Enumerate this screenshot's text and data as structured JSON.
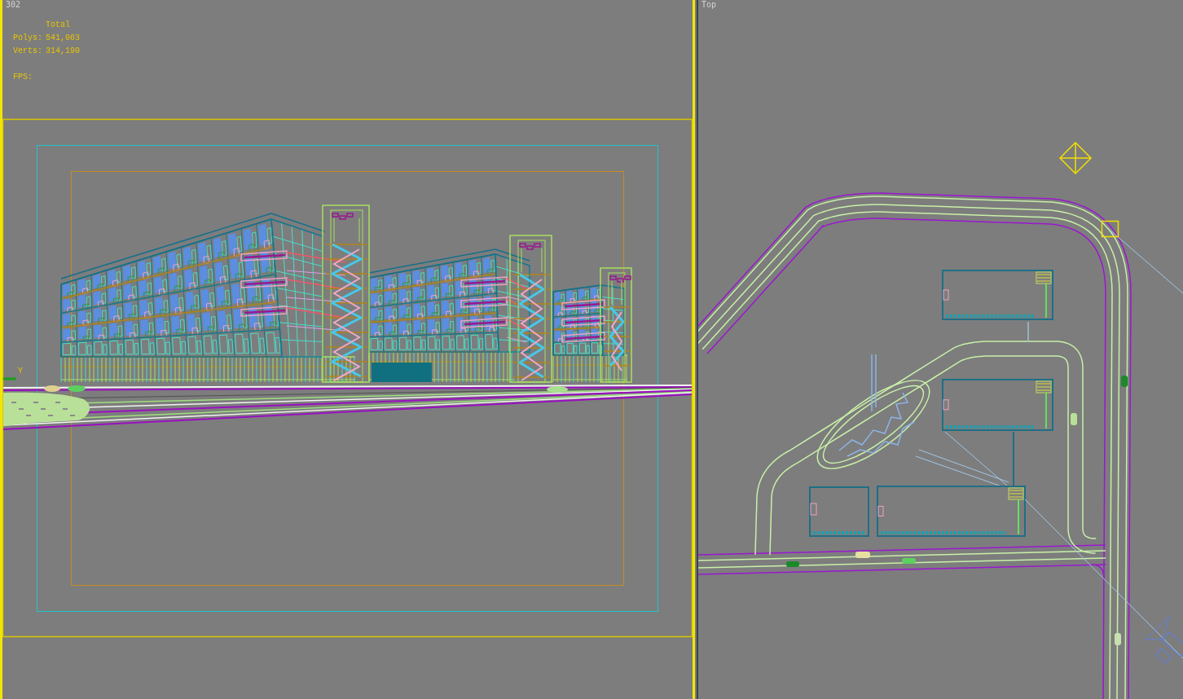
{
  "viewports": [
    {
      "kind": "camera",
      "label": "302",
      "selected": true,
      "stats": {
        "heading": "Total",
        "rows": [
          {
            "label": "Polys:",
            "value": "541,063"
          },
          {
            "label": "Verts:",
            "value": "314,190"
          }
        ],
        "fps_label": "FPS:"
      },
      "axis_label": "Y"
    },
    {
      "kind": "top",
      "label": "Top",
      "selected": false
    }
  ]
}
